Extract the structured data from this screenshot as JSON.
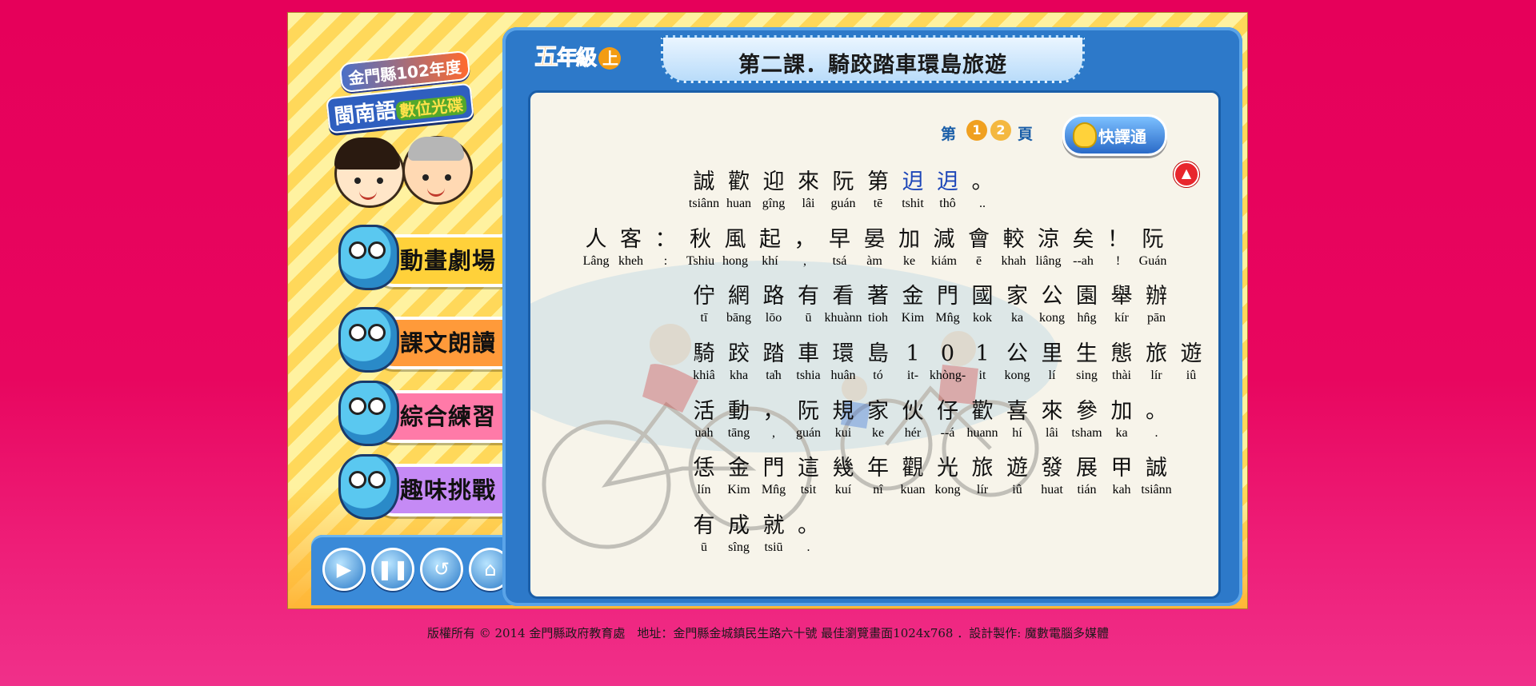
{
  "logo": {
    "line1": "金門縣102年度",
    "line2_main": "閩南語",
    "line2_sub": "數位光碟"
  },
  "menu": [
    {
      "label": "動畫劇場",
      "color": "#ffd13a"
    },
    {
      "label": "課文朗讀",
      "color": "#ff9a3a"
    },
    {
      "label": "綜合練習",
      "color": "#ff7aa8"
    },
    {
      "label": "趣味挑戰",
      "color": "#c58af5"
    }
  ],
  "controls": [
    {
      "name": "play-icon",
      "glyph": "▶"
    },
    {
      "name": "pause-icon",
      "glyph": "❚❚"
    },
    {
      "name": "replay-icon",
      "glyph": "↺"
    },
    {
      "name": "home-icon",
      "glyph": "⌂"
    }
  ],
  "grade": {
    "wu": "五",
    "nian": "年",
    "ji": "級",
    "shang": "上"
  },
  "lesson_title": "第二課．騎跤踏車環島旅遊",
  "pages": {
    "prefix": "第",
    "suffix": "頁",
    "items": [
      "1",
      "2"
    ],
    "current": "1"
  },
  "quick_button": "快譯通",
  "up_glyph": "▲",
  "text_rows": [
    [
      [
        "誠",
        "tsiânn"
      ],
      [
        "歡",
        "huan"
      ],
      [
        "迎",
        "gîng"
      ],
      [
        "來",
        "lâi"
      ],
      [
        "阮",
        "guán"
      ],
      [
        "第",
        "tē"
      ],
      [
        "迌",
        "tshit"
      ],
      [
        "迌",
        "thô"
      ],
      [
        "。",
        ".."
      ]
    ],
    [
      [
        "人",
        "Lâng"
      ],
      [
        "客",
        "kheh"
      ],
      [
        "：",
        ":"
      ],
      [
        "秋",
        "Tshiu"
      ],
      [
        "風",
        "hong"
      ],
      [
        "起",
        "khí"
      ],
      [
        "，",
        ","
      ],
      [
        "早",
        "tsá"
      ],
      [
        "晏",
        "àm"
      ],
      [
        "加",
        "ke"
      ],
      [
        "減",
        "kiám"
      ],
      [
        "會",
        "ē"
      ],
      [
        "較",
        "khah"
      ],
      [
        "涼",
        "liâng"
      ],
      [
        "矣",
        "--ah"
      ],
      [
        "！",
        "!"
      ],
      [
        "阮",
        "Guán"
      ]
    ],
    [
      [
        "佇",
        "tī"
      ],
      [
        "網",
        "bāng"
      ],
      [
        "路",
        "lōo"
      ],
      [
        "有",
        "ū"
      ],
      [
        "看",
        "khuànn"
      ],
      [
        "著",
        "tioh"
      ],
      [
        "金",
        "Kim"
      ],
      [
        "門",
        "Mn̂g"
      ],
      [
        "國",
        "kok"
      ],
      [
        "家",
        "ka"
      ],
      [
        "公",
        "kong"
      ],
      [
        "園",
        "hn̂g"
      ],
      [
        "舉",
        "kír"
      ],
      [
        "辦",
        "pān"
      ]
    ],
    [
      [
        "騎",
        "khiâ"
      ],
      [
        "跤",
        "kha"
      ],
      [
        "踏",
        "ta̍h"
      ],
      [
        "車",
        "tshia"
      ],
      [
        "環",
        "huân"
      ],
      [
        "島",
        "tó"
      ],
      [
        "1",
        "it-"
      ],
      [
        "0",
        "khòng-"
      ],
      [
        "1",
        "it"
      ],
      [
        "公",
        "kong"
      ],
      [
        "里",
        "lí"
      ],
      [
        "生",
        "sing"
      ],
      [
        "態",
        "thài"
      ],
      [
        "旅",
        "lír"
      ],
      [
        "遊",
        "iû"
      ]
    ],
    [
      [
        "活",
        "uah"
      ],
      [
        "動",
        "tāng"
      ],
      [
        "，",
        ","
      ],
      [
        "阮",
        "guán"
      ],
      [
        "規",
        "kui"
      ],
      [
        "家",
        "ke"
      ],
      [
        "伙",
        "hér"
      ],
      [
        "仔",
        "--á"
      ],
      [
        "歡",
        "huann"
      ],
      [
        "喜",
        "hí"
      ],
      [
        "來",
        "lâi"
      ],
      [
        "參",
        "tsham"
      ],
      [
        "加",
        "ka"
      ],
      [
        "。",
        "."
      ]
    ],
    [
      [
        "恁",
        "lín"
      ],
      [
        "金",
        "Kim"
      ],
      [
        "門",
        "Mn̂g"
      ],
      [
        "這",
        "tsit"
      ],
      [
        "幾",
        "kuí"
      ],
      [
        "年",
        "nî"
      ],
      [
        "觀",
        "kuan"
      ],
      [
        "光",
        "kong"
      ],
      [
        "旅",
        "lír"
      ],
      [
        "遊",
        "iû"
      ],
      [
        "發",
        "huat"
      ],
      [
        "展",
        "tián"
      ],
      [
        "甲",
        "kah"
      ],
      [
        "誠",
        "tsiânn"
      ]
    ],
    [
      [
        "有",
        "ū"
      ],
      [
        "成",
        "sîng"
      ],
      [
        "就",
        "tsiū"
      ],
      [
        "。",
        "."
      ]
    ]
  ],
  "footer": "版權所有 © 2014 金門縣政府教育處　地址：金門縣金城鎮民生路六十號 最佳瀏覽畫面1024x768 ．設計製作: 魔數電腦多媒體",
  "colors": {
    "background": "#e6005a",
    "panel": "#2d79c9",
    "paper": "#f7f4ea",
    "highlight": "#1c45b8"
  }
}
